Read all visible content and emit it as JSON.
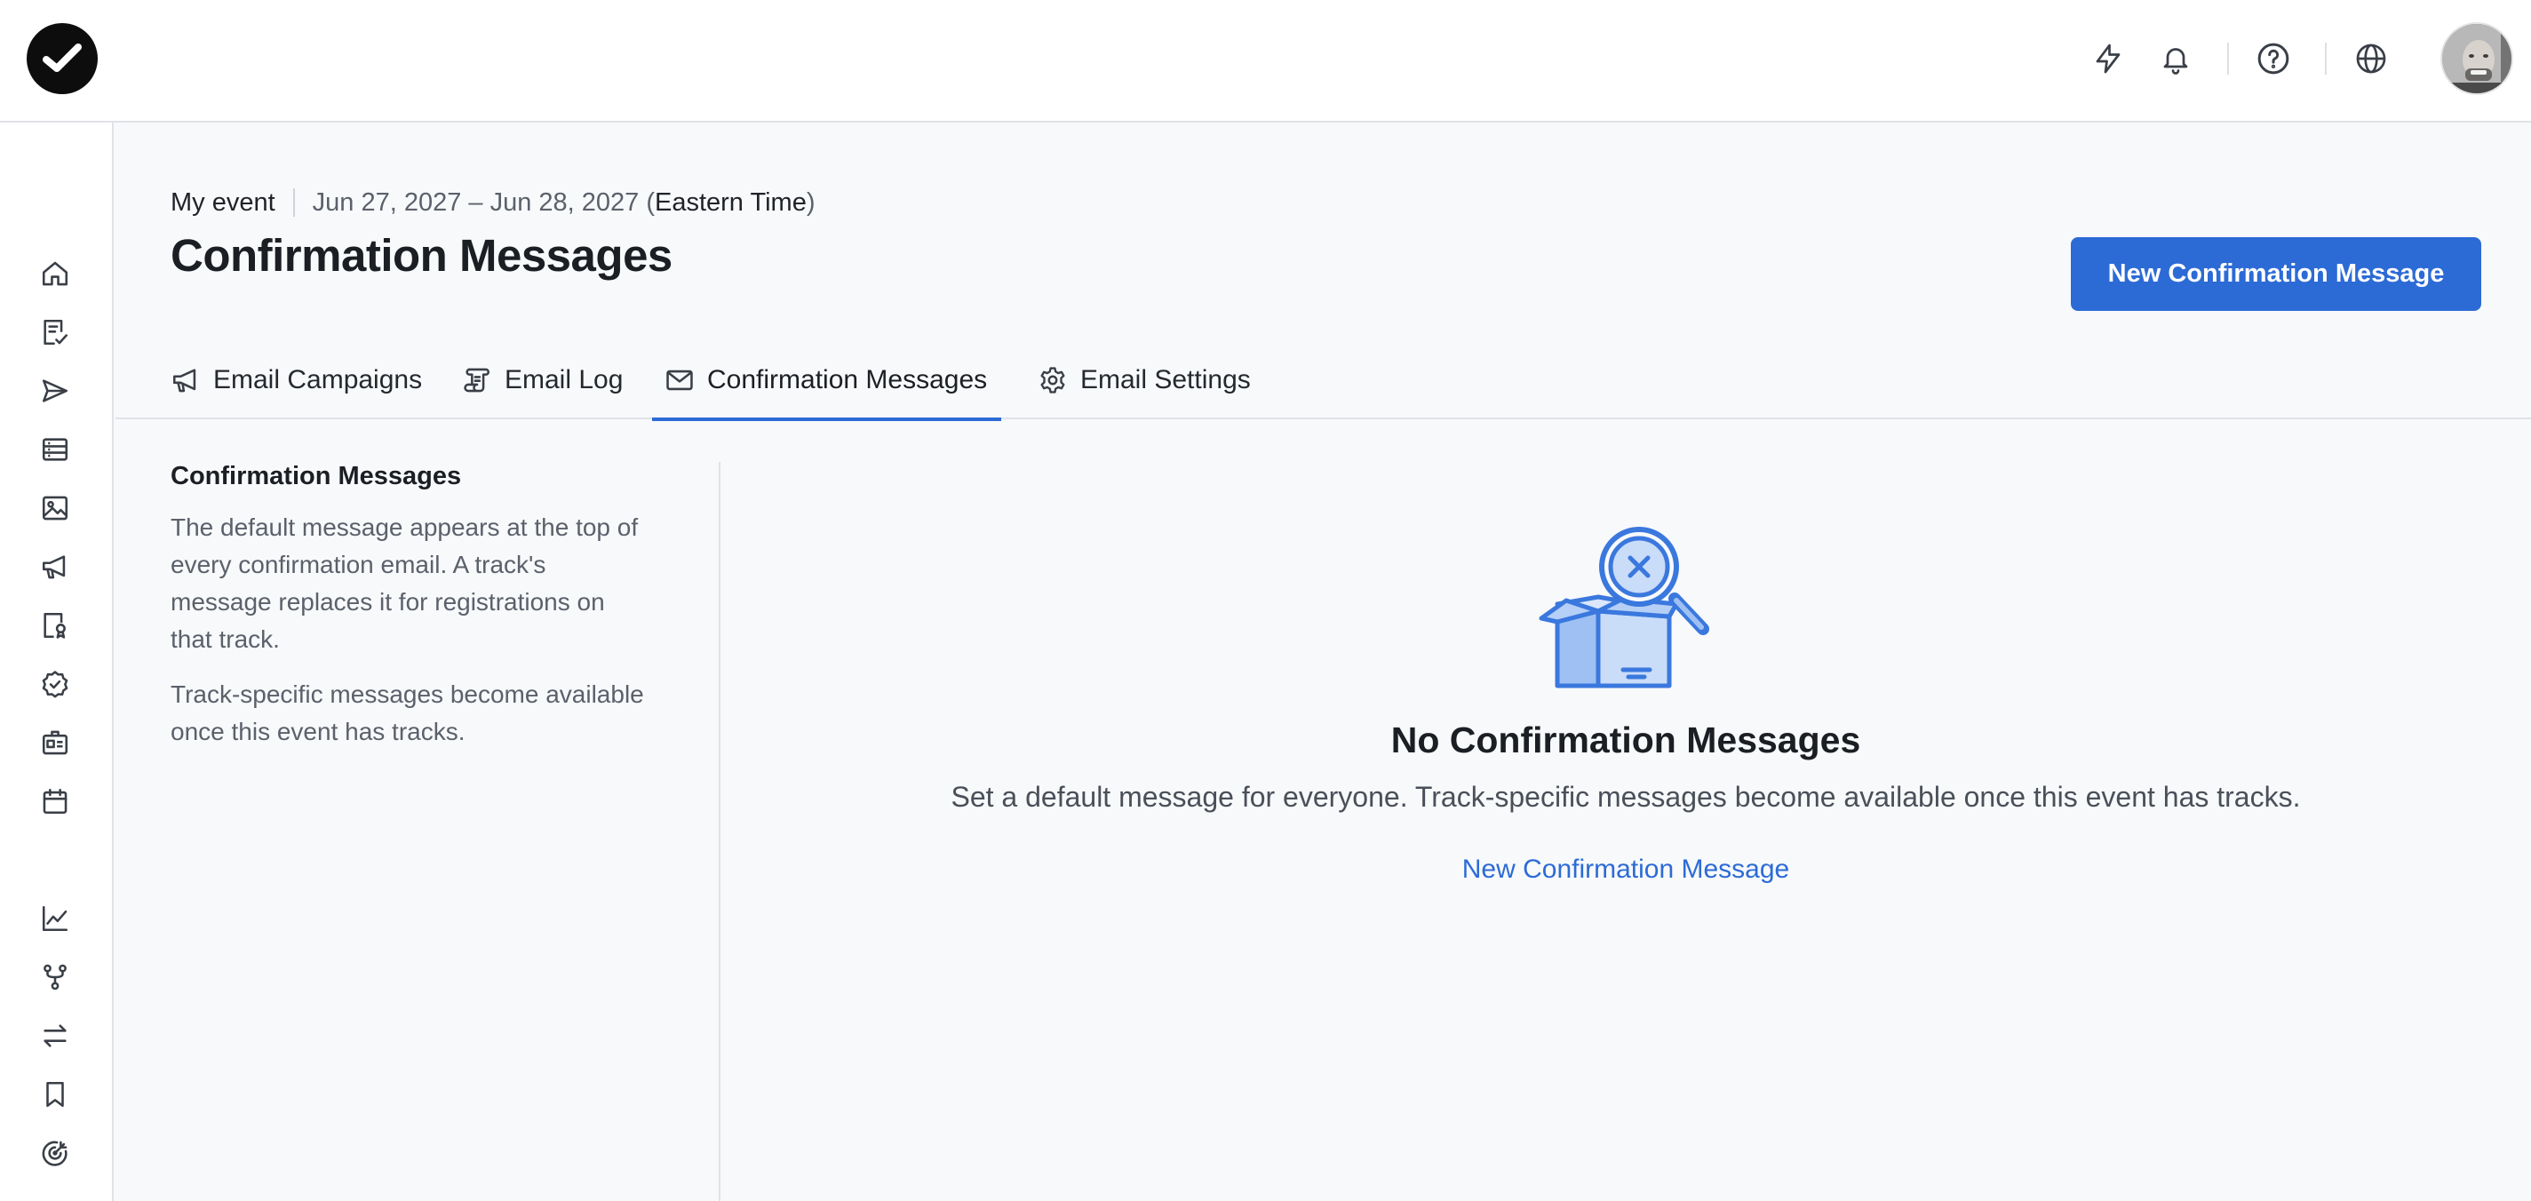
{
  "header": {
    "event_name": "My event",
    "event_dates": "Jun 27, 2027 – Jun 28, 2027",
    "event_tz_open": "(",
    "event_tz": "Eastern Time",
    "event_tz_close": ")",
    "page_title": "Confirmation Messages",
    "primary_button": "New Confirmation Message"
  },
  "tabs": [
    {
      "label": "Email Campaigns",
      "icon": "megaphone-icon",
      "active": false
    },
    {
      "label": "Email Log",
      "icon": "scroll-icon",
      "active": false
    },
    {
      "label": "Confirmation Messages",
      "icon": "envelope-icon",
      "active": true
    },
    {
      "label": "Email Settings",
      "icon": "gear-icon",
      "active": false
    }
  ],
  "side": {
    "title": "Confirmation Messages",
    "paragraphs": [
      "The default message appears at the top of every confirmation email. A track's message replaces it for registrations on that track.",
      "Track-specific messages become available once this event has tracks."
    ]
  },
  "empty_state": {
    "icon": "empty-box-search-icon",
    "title": "No Confirmation Messages",
    "description": "Set a default message for everyone. Track-specific messages become available once this event has tracks.",
    "link": "New Confirmation Message"
  },
  "topbar_icons": [
    "lightning-icon",
    "bell-icon",
    "help-icon",
    "globe-icon",
    "avatar"
  ],
  "rail_icons": [
    "home-icon",
    "checklist-icon",
    "send-icon",
    "list-icon",
    "image-icon",
    "megaphone-icon",
    "badge-icon",
    "verified-icon",
    "id-card-icon",
    "calendar-icon",
    "chart-icon",
    "branch-icon",
    "swap-icon",
    "bookmark-icon",
    "target-icon"
  ],
  "colors": {
    "accent": "#2c6bd6",
    "background": "#f8f9fb",
    "illustration_light": "#c9dcf8",
    "illustration_stroke": "#3a78de"
  }
}
